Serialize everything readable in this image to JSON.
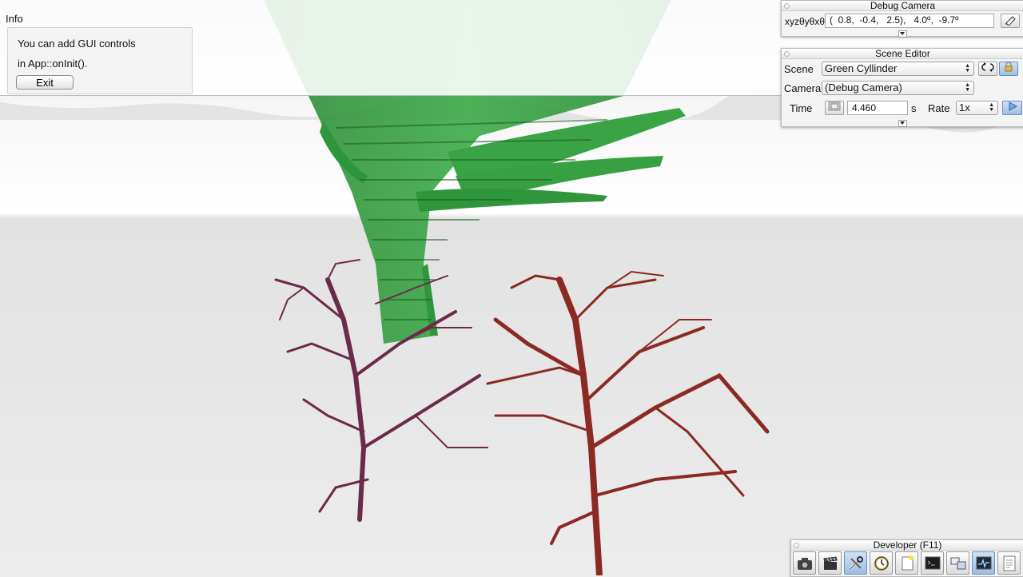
{
  "info": {
    "title": "Info",
    "line1": "You can add GUI controls",
    "line2": "in App::onInit().",
    "exit_label": "Exit"
  },
  "debug_camera": {
    "title": "Debug Camera",
    "label": "xyzθyθxθz",
    "value": "(  0.8,  -0.4,   2.5),   4.0º,  -9.7º"
  },
  "scene_editor": {
    "title": "Scene Editor",
    "scene_label": "Scene",
    "scene_value": "Green Cyllinder",
    "camera_label": "Camera",
    "camera_value": "(Debug Camera)",
    "time_label": "Time",
    "time_value": "4.460",
    "time_unit": "s",
    "rate_label": "Rate",
    "rate_value": "1x"
  },
  "developer": {
    "title": "Developer (F11)",
    "tools": [
      "camera-icon",
      "film-clapper-icon",
      "wrench-icon",
      "clock-icon",
      "new-document-icon",
      "terminal-icon",
      "window-layout-icon",
      "profiler-icon",
      "notes-icon"
    ]
  },
  "colors": {
    "cylinder_green": "#2e9b3d",
    "left_tree": "#6b2a4a",
    "right_tree": "#8a2a22",
    "accent_blue": "#7fa9d9"
  }
}
